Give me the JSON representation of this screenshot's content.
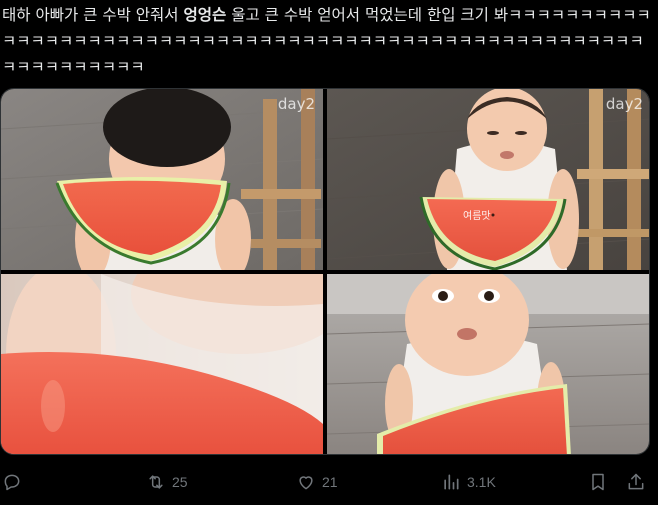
{
  "tweet": {
    "text_before": "태하 아빠가 큰 수박 안줘서 ",
    "text_bold": "엉엉슨",
    "text_after": " 울고 큰 수박 얻어서 먹었는데 한입 크기 봐ㅋㅋㅋㅋㅋㅋㅋㅋㅋㅋㅋㅋㅋㅋㅋㅋㅋㅋㅋㅋㅋㅋㅋㅋㅋㅋㅋㅋㅋㅋㅋㅋㅋㅋㅋㅋㅋㅋㅋㅋㅋㅋㅋㅋㅋㅋㅋㅋㅋㅋㅋㅋㅋㅋㅋㅋㅋㅋㅋㅋㅋㅋㅋㅋㅋ"
  },
  "media": {
    "photo1_day": "day2",
    "photo2_day": "day2",
    "photo2_caption": "여름맛"
  },
  "actions": {
    "reply_count": "",
    "retweet_count": "25",
    "like_count": "21",
    "views_count": "3.1K"
  },
  "icons": {
    "reply": "reply-icon",
    "retweet": "retweet-icon",
    "like": "heart-icon",
    "views": "views-icon",
    "bookmark": "bookmark-icon",
    "share": "share-icon"
  },
  "colors": {
    "background": "#000000",
    "text": "#e7e9ea",
    "muted": "#71767b",
    "border": "#2f3336"
  }
}
